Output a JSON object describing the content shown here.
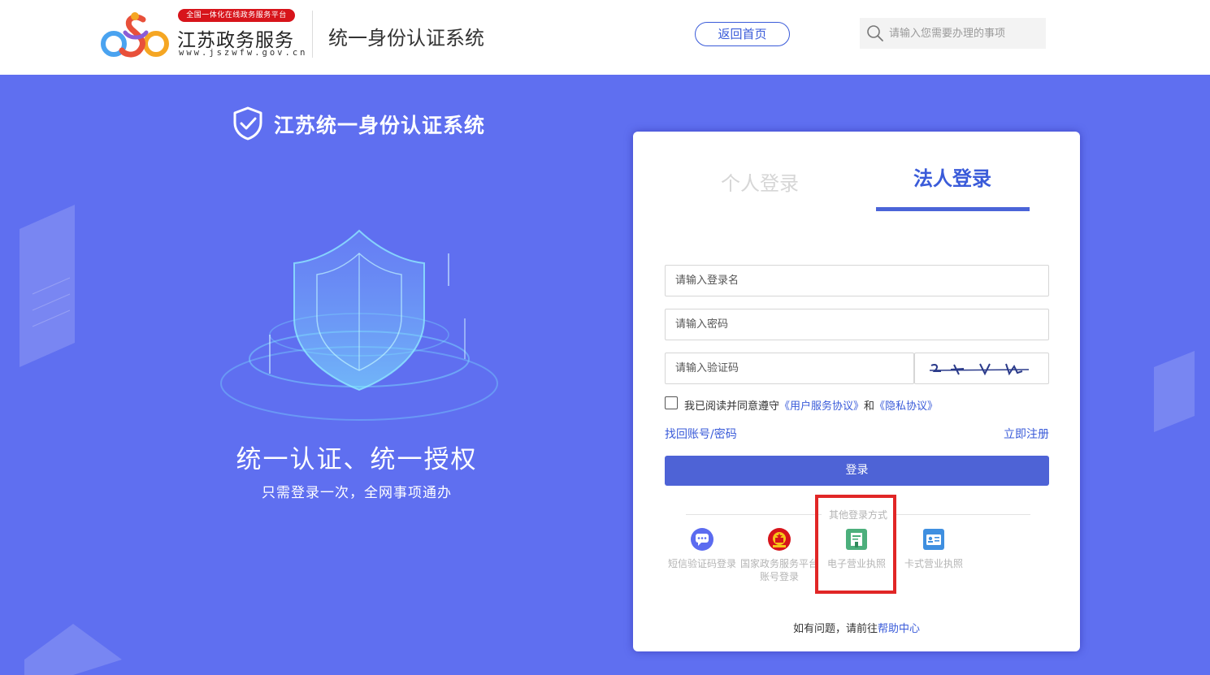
{
  "header": {
    "brand_badge": "全国一体化在线政务服务平台",
    "brand_name": "江苏政务服务",
    "brand_url": "www.jszwfw.gov.cn",
    "system_title": "统一身份认证系统",
    "home_button": "返回首页",
    "search_placeholder": "请输入您需要办理的事项"
  },
  "hero": {
    "title": "江苏统一身份认证系统",
    "slogan": "统一认证、统一授权",
    "sub_slogan": "只需登录一次，全网事项通办"
  },
  "login": {
    "tabs": [
      {
        "label": "个人登录",
        "active": false
      },
      {
        "label": "法人登录",
        "active": true
      }
    ],
    "username_placeholder": "请输入登录名",
    "password_placeholder": "请输入密码",
    "captcha_placeholder": "请输入验证码",
    "agree_prefix": "我已阅读并同意遵守",
    "agree_link_service": "《用户服务协议》",
    "agree_and": "和",
    "agree_link_privacy": "《隐私协议》",
    "forgot_link": "找回账号/密码",
    "register_link": "立即注册",
    "login_button": "登录",
    "other_methods_label": "其他登录方式",
    "methods": [
      {
        "icon": "chat-bubble-icon",
        "label": "短信验证码登录",
        "color": "#5b6bf0"
      },
      {
        "icon": "national-emblem-icon",
        "label": "国家政务服务平台账号登录",
        "color": "#d7141b"
      },
      {
        "icon": "electronic-license-icon",
        "label": "电子营业执照",
        "color": "#4caf7c"
      },
      {
        "icon": "id-card-icon",
        "label": "卡式营业执照",
        "color": "#3f8fe0"
      }
    ],
    "help_prefix": "如有问题，请前往",
    "help_link": "帮助中心"
  },
  "colors": {
    "hero_background": "#5f6ff0",
    "accent": "#3a5bd9",
    "login_button": "#4e63d6",
    "highlight": "#e12626"
  }
}
